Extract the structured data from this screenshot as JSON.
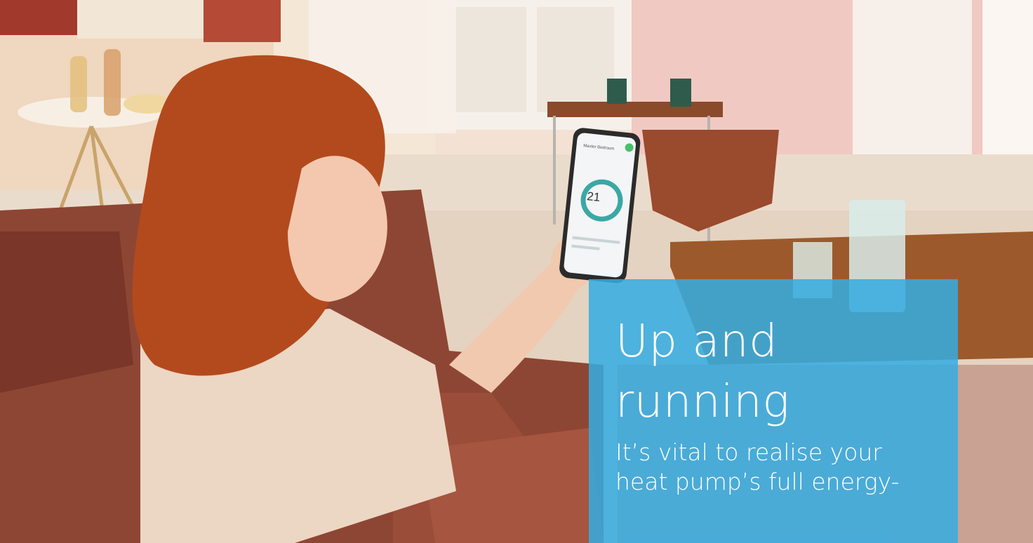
{
  "hero": {
    "heading_line1": "Up and",
    "heading_line2": "running",
    "body_line1": "It’s vital to realise your",
    "body_line2": "heat pump’s full energy-"
  },
  "phone_app": {
    "room_name": "Master Bedroom",
    "temperature": "21"
  },
  "colors": {
    "overlay": "#34ace2",
    "wall_pink": "#f1c9c3",
    "sofa": "#8e4634",
    "hair": "#b34a1d"
  }
}
